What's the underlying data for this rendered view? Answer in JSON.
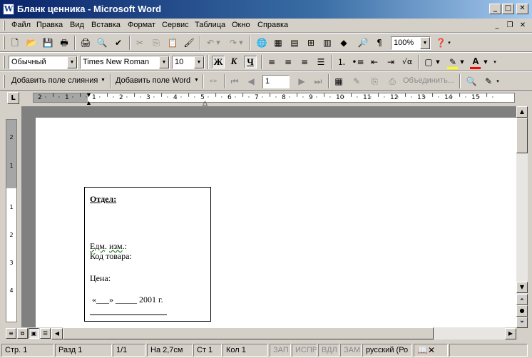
{
  "window": {
    "title": "Бланк ценника - Microsoft Word",
    "app_icon": "W"
  },
  "menu": [
    "Файл",
    "Правка",
    "Вид",
    "Вставка",
    "Формат",
    "Сервис",
    "Таблица",
    "Окно",
    "Справка"
  ],
  "standard_toolbar": {
    "zoom": "100%"
  },
  "formatting_toolbar": {
    "style": "Обычный",
    "font": "Times New Roman",
    "size": "10",
    "bold_label": "Ж",
    "italic_label": "К",
    "underline_label": "Ч",
    "highlight_color": "#ffff00",
    "font_color": "#ff0000"
  },
  "mail_merge_toolbar": {
    "add_merge_field": "Добавить поле слияния",
    "add_word_field": "Добавить поле Word",
    "record": "1",
    "merge_label": "Объединить..."
  },
  "ruler": {
    "h_ticks": [
      "2",
      "1",
      "1",
      "2",
      "3",
      "4",
      "5",
      "6",
      "7",
      "8",
      "9",
      "10",
      "11",
      "12",
      "13",
      "14",
      "15"
    ],
    "v_ticks": [
      "2",
      "1",
      "1",
      "2",
      "3",
      "4"
    ]
  },
  "document": {
    "dept": "Отдел:",
    "unit_word": "Едм",
    "unit_rest": ".",
    "unit_word2": "изм",
    "unit_tail": ".:",
    "product_code": "Код товара:",
    "price": "Цена:",
    "date_line": "«___» _____ 2001 г."
  },
  "status": {
    "page": "Стр.  1",
    "section": "Разд  1",
    "pages": "1/1",
    "position": "На  2,7см",
    "line": "Ст  1",
    "column": "Кол  1",
    "rec": "ЗАП",
    "trk": "ИСПР",
    "ext": "ВДЛ",
    "ovr": "ЗАМ",
    "language": "русский (Ро"
  }
}
